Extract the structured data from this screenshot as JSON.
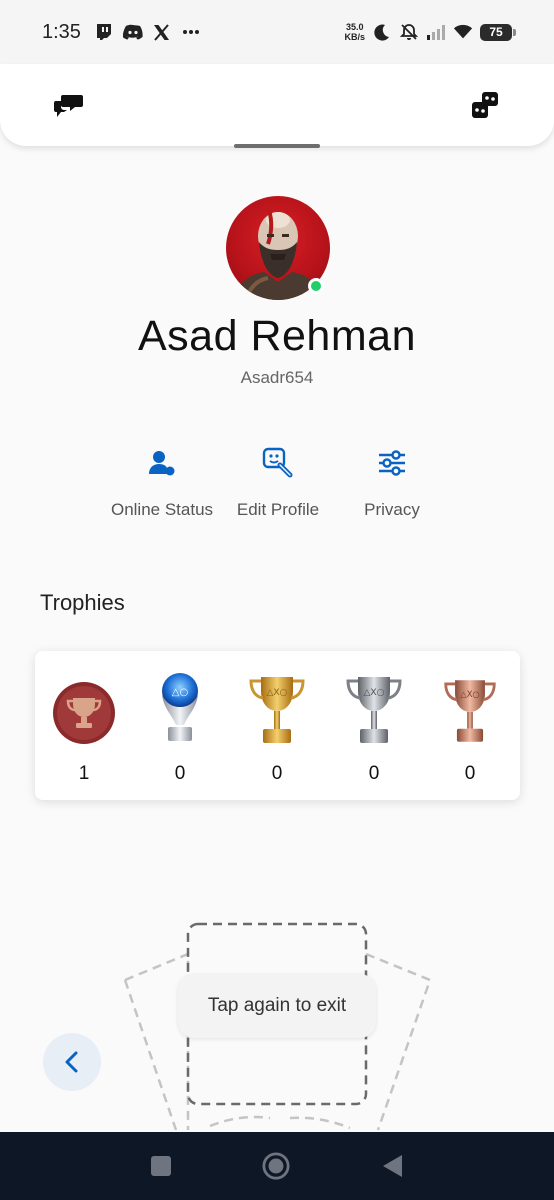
{
  "status_bar": {
    "time": "1:35",
    "notification_icons": [
      "twitch-icon",
      "discord-icon",
      "x-icon",
      "more-icon"
    ],
    "net_speed_value": "35.0",
    "net_speed_unit": "KB/s",
    "battery": "75"
  },
  "header": {
    "left_icon": "chat-bubbles-icon",
    "right_icon": "game-pieces-icon"
  },
  "profile": {
    "display_name": "Asad Rehman",
    "online_id": "Asadr654",
    "online": true,
    "status_color": "#1fcf6a"
  },
  "actions": [
    {
      "label": "Online Status",
      "icon": "user-status-icon"
    },
    {
      "label": "Edit Profile",
      "icon": "edit-profile-icon"
    },
    {
      "label": "Privacy",
      "icon": "sliders-icon"
    }
  ],
  "trophies": {
    "title": "Trophies",
    "items": [
      {
        "type": "level",
        "count": "1"
      },
      {
        "type": "platinum",
        "count": "0"
      },
      {
        "type": "gold",
        "count": "0"
      },
      {
        "type": "silver",
        "count": "0"
      },
      {
        "type": "bronze",
        "count": "0"
      }
    ]
  },
  "toast": {
    "message": "Tap again to exit"
  },
  "colors": {
    "accent": "#0a63c2",
    "nav_bar": "#0e1726"
  }
}
